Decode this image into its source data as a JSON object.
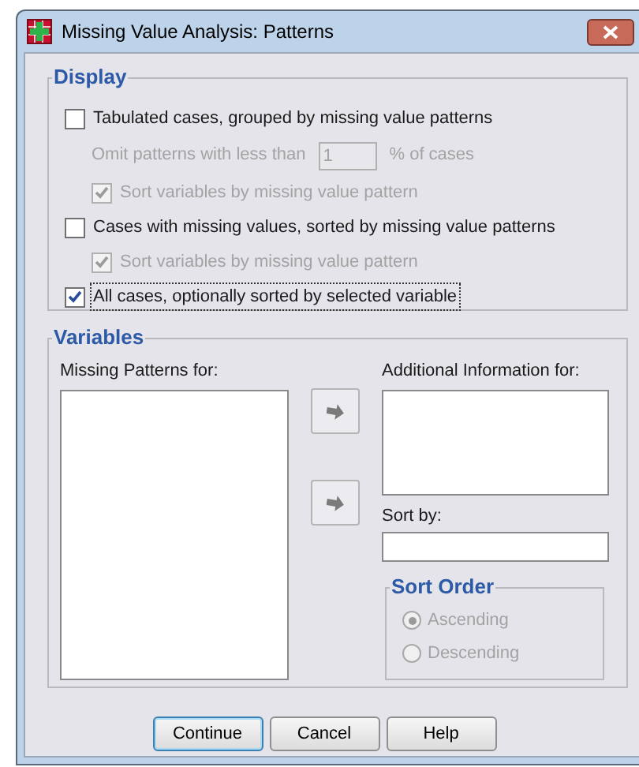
{
  "window": {
    "title": "Missing Value Analysis: Patterns"
  },
  "display": {
    "title": "Display",
    "items": [
      {
        "kind": "checkbox",
        "label": "Tabulated cases, grouped by missing value patterns",
        "checked": false,
        "disabled": false,
        "focused": false,
        "children": [
          {
            "kind": "field",
            "label": "Omit patterns with less than",
            "value": "1",
            "suffix": "% of cases",
            "disabled": true
          },
          {
            "kind": "checkbox",
            "label": "Sort variables by missing value pattern",
            "checked": true,
            "disabled": true,
            "focused": false
          }
        ]
      },
      {
        "kind": "checkbox",
        "label": "Cases with missing values, sorted by missing value patterns",
        "checked": false,
        "disabled": false,
        "focused": false,
        "children": [
          {
            "kind": "checkbox",
            "label": "Sort variables by missing value pattern",
            "checked": true,
            "disabled": true,
            "focused": false
          }
        ]
      },
      {
        "kind": "checkbox",
        "label": "All cases, optionally sorted by selected variable",
        "checked": true,
        "disabled": false,
        "focused": true
      }
    ]
  },
  "variables": {
    "title": "Variables",
    "missing_patterns_label": "Missing Patterns for:",
    "additional_label": "Additional Information for:",
    "sort_by_label": "Sort by:",
    "sort_order": {
      "title": "Sort Order",
      "options": [
        {
          "label": "Ascending",
          "selected": true,
          "disabled": true
        },
        {
          "label": "Descending",
          "selected": false,
          "disabled": true
        }
      ]
    }
  },
  "buttons": [
    {
      "label": "Continue",
      "default": true
    },
    {
      "label": "Cancel",
      "default": false
    },
    {
      "label": "Help",
      "default": false
    }
  ]
}
